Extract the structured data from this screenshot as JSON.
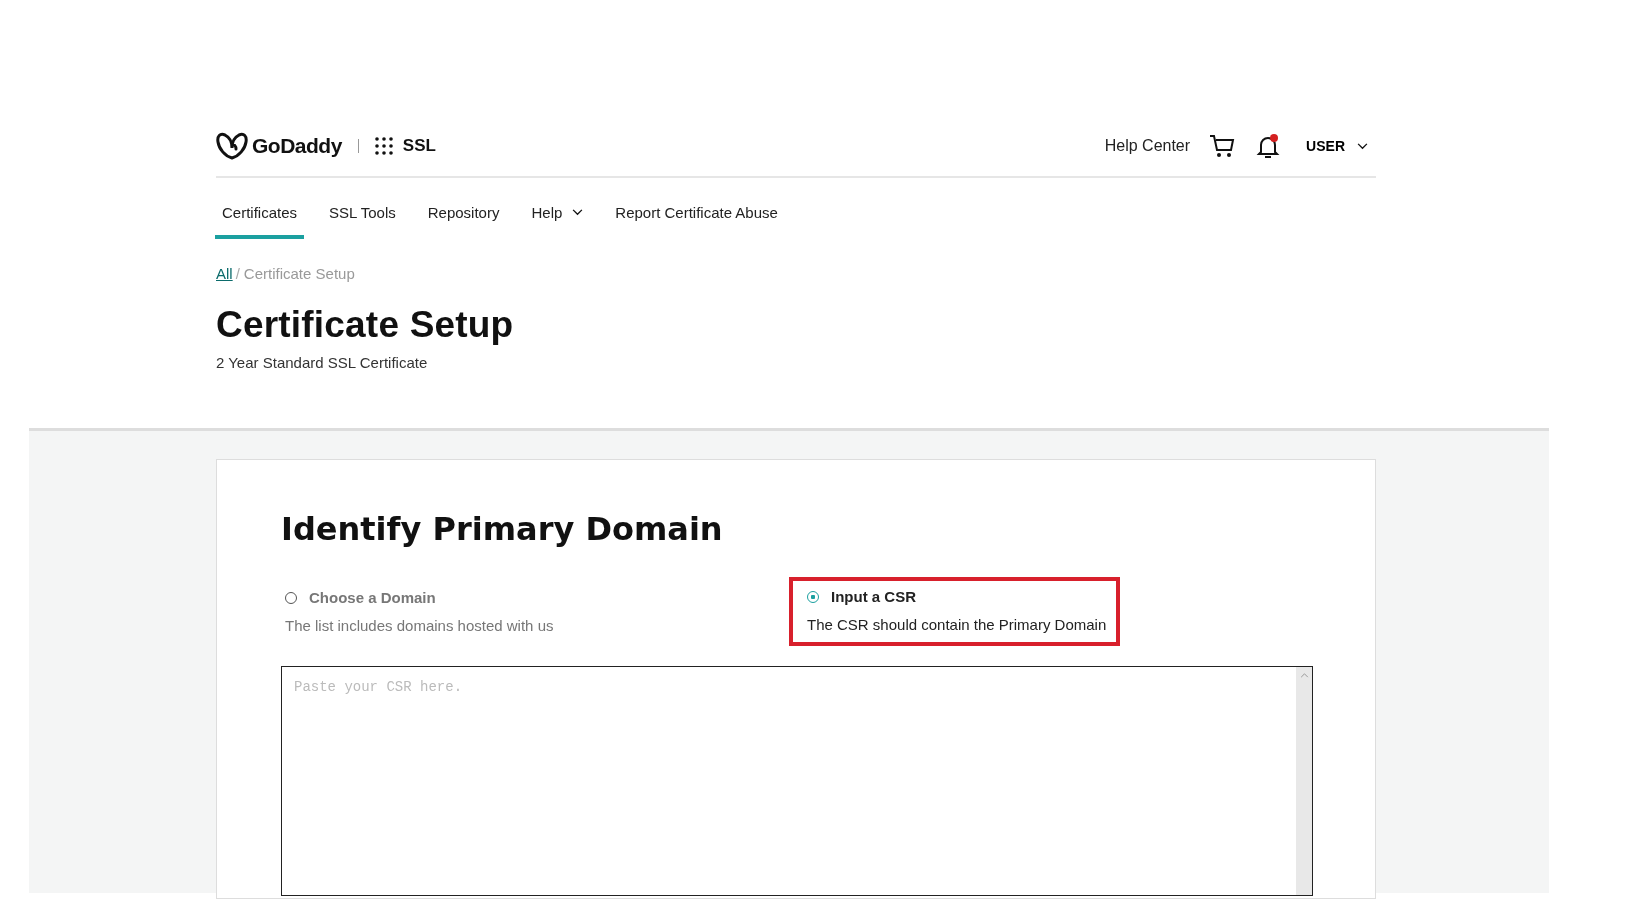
{
  "header": {
    "brand": "GoDaddy",
    "product": "SSL",
    "help_link": "Help Center",
    "notification_unread": true,
    "user": "USER"
  },
  "nav": [
    {
      "label": "Certificates",
      "selected": true,
      "dropdown": false
    },
    {
      "label": "SSL Tools",
      "selected": false,
      "dropdown": false
    },
    {
      "label": "Repository",
      "selected": false,
      "dropdown": false
    },
    {
      "label": "Help",
      "selected": false,
      "dropdown": true
    },
    {
      "label": "Report Certificate Abuse",
      "selected": false,
      "dropdown": false
    }
  ],
  "breadcrumb": {
    "link": "All",
    "separator": "/",
    "current": "Certificate Setup"
  },
  "page_title": "Certificate Setup",
  "page_subtitle": "2 Year Standard SSL Certificate",
  "card": {
    "heading": "Identify Primary Domain",
    "options": [
      {
        "label": "Choose a Domain",
        "description": "The list includes domains hosted with us",
        "selected": false,
        "highlighted": false
      },
      {
        "label": "Input a CSR",
        "description": "The CSR should contain the Primary Domain",
        "selected": true,
        "highlighted": true
      }
    ],
    "csr_field": {
      "placeholder": "Paste your CSR here."
    }
  }
}
